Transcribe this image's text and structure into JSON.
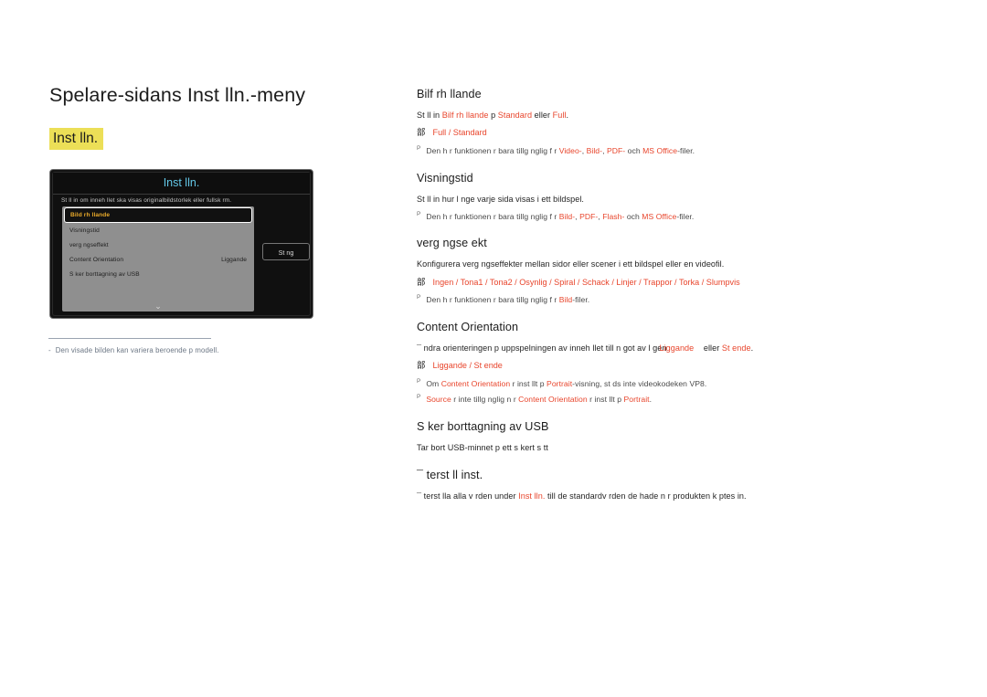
{
  "page": {
    "title": "Spelare-sidans Inst lln.-meny",
    "section_chip": "Inst lln."
  },
  "osd": {
    "title": "Inst lln.",
    "description": "St ll in om inneh llet ska visas originalbildstorlek eller fullsk rm.",
    "close_button": "St ng",
    "chevron": "⌄",
    "rows": [
      {
        "label": "Bild rh llande",
        "value": "",
        "selected": true
      },
      {
        "label": "Visningstid",
        "value": "",
        "selected": false
      },
      {
        "label": " verg ngseffekt",
        "value": "",
        "selected": false
      },
      {
        "label": "Content Orientation",
        "value": "Liggande",
        "selected": false
      },
      {
        "label": "S ker borttagning av USB",
        "value": "",
        "selected": false
      }
    ]
  },
  "footnote": {
    "dash": "-",
    "text": "Den visade bilden kan variera beroende p  modell."
  },
  "sections": [
    {
      "heading": "Bilf rh llande",
      "desc_parts": [
        {
          "t": "St ll in ",
          "a": false
        },
        {
          "t": "Bilf rh llande",
          "a": true
        },
        {
          "t": " p  ",
          "a": false
        },
        {
          "t": "Standard",
          "a": true
        },
        {
          "t": " eller ",
          "a": false
        },
        {
          "t": "Full",
          "a": true
        },
        {
          "t": ".",
          "a": false
        }
      ],
      "options_bullet": "部",
      "options": "Full / Standard",
      "notes": [
        {
          "mark": "P",
          "parts": [
            {
              "t": "Den h r funktionen  r bara tillg nglig f r ",
              "a": false
            },
            {
              "t": "Video-",
              "a": true
            },
            {
              "t": ", ",
              "a": false
            },
            {
              "t": "Bild-",
              "a": true
            },
            {
              "t": ", ",
              "a": false
            },
            {
              "t": "PDF-",
              "a": true
            },
            {
              "t": " och ",
              "a": false
            },
            {
              "t": "MS Office",
              "a": true
            },
            {
              "t": "-filer.",
              "a": false
            }
          ]
        }
      ]
    },
    {
      "heading": "Visningstid",
      "desc_parts": [
        {
          "t": "St ll in hur l nge varje sida visas i ett bildspel.",
          "a": false
        }
      ],
      "options_bullet": "",
      "options": "",
      "notes": [
        {
          "mark": "P",
          "parts": [
            {
              "t": "Den h r funktionen  r bara tillg nglig f r ",
              "a": false
            },
            {
              "t": "Bild-",
              "a": true
            },
            {
              "t": ", ",
              "a": false
            },
            {
              "t": "PDF-",
              "a": true
            },
            {
              "t": ", ",
              "a": false
            },
            {
              "t": "Flash-",
              "a": true
            },
            {
              "t": " och ",
              "a": false
            },
            {
              "t": "MS Office",
              "a": true
            },
            {
              "t": "-filer.",
              "a": false
            }
          ]
        }
      ]
    },
    {
      "heading": " verg ngse ekt",
      "desc_parts": [
        {
          "t": "Konfigurera  verg ngseffekter mellan sidor eller scener i ett bildspel eller en videofil.",
          "a": false
        }
      ],
      "options_bullet": "部",
      "options": "Ingen / Tona1 / Tona2 / Osynlig / Spiral / Schack / Linjer / Trappor / Torka / Slumpvis",
      "notes": [
        {
          "mark": "P",
          "parts": [
            {
              "t": "Den h r funktionen  r bara tillg nglig f r ",
              "a": false
            },
            {
              "t": "Bild",
              "a": true
            },
            {
              "t": "-filer.",
              "a": false
            }
          ]
        }
      ]
    },
    {
      "heading": "Content Orientation",
      "desc_parts": [
        {
          "t": "¯ ndra orienteringen p  uppspelningen av inneh llet till n got av l gen",
          "a": false
        }
      ],
      "overlap": {
        "over_text": "Liggande",
        "tail_parts": [
          {
            "t": " eller ",
            "a": false
          },
          {
            "t": "St ende",
            "a": true
          },
          {
            "t": ".",
            "a": false
          }
        ]
      },
      "options_bullet": "部",
      "options": "Liggande / St ende",
      "notes": [
        {
          "mark": "P",
          "parts": [
            {
              "t": "Om ",
              "a": false
            },
            {
              "t": "Content Orientation",
              "a": true
            },
            {
              "t": "  r inst llt p  ",
              "a": false
            },
            {
              "t": "Portrait",
              "a": true
            },
            {
              "t": "-visning, st ds inte videokodeken VP8.",
              "a": false
            }
          ]
        },
        {
          "mark": "P",
          "parts": [
            {
              "t": "Source",
              "a": true
            },
            {
              "t": "  r inte tillg nglig n r ",
              "a": false
            },
            {
              "t": "Content Orientation",
              "a": true
            },
            {
              "t": "  r inst llt p  ",
              "a": false
            },
            {
              "t": "Portrait",
              "a": true
            },
            {
              "t": ".",
              "a": false
            }
          ]
        }
      ]
    },
    {
      "heading": "S ker borttagning av USB",
      "desc_parts": [
        {
          "t": "Tar bort USB-minnet p  ett s kert s tt",
          "a": false
        }
      ],
      "options_bullet": "",
      "options": "",
      "notes": []
    },
    {
      "heading": "¯ terst ll inst.",
      "desc_parts": [
        {
          "t": "¯ terst lla alla v rden under ",
          "a": false
        },
        {
          "t": "Inst lln.",
          "a": true
        },
        {
          "t": " till de standardv rden de hade n r produkten k ptes in.",
          "a": false
        }
      ],
      "options_bullet": "",
      "options": "",
      "notes": []
    }
  ],
  "colors": {
    "accent_red": "#e8452c",
    "chip_yellow": "#ecdf57",
    "osd_title_cyan": "#63c7e6",
    "osd_selected_amber": "#e8a92a",
    "footnote_gray": "#6b7684"
  }
}
